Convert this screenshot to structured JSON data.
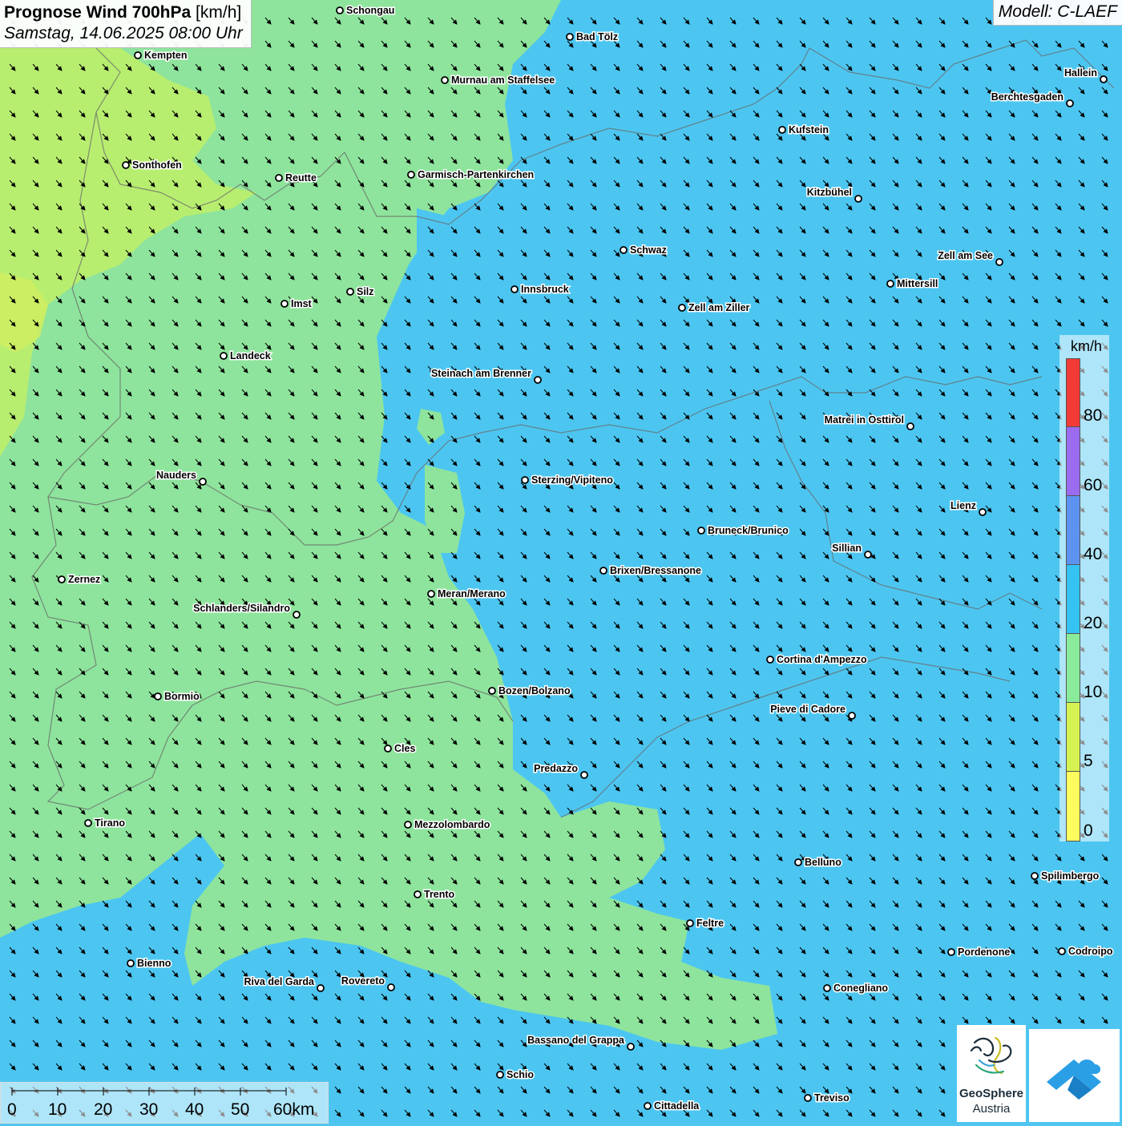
{
  "title": {
    "main": "Prognose Wind 700hPa",
    "unit": "[km/h]",
    "date": "Samstag, 14.06.2025 08:00 Uhr"
  },
  "model": "Modell: C-LAEF",
  "legend": {
    "unit": "km/h",
    "labels": [
      "80",
      "60",
      "40",
      "20",
      "10",
      "5",
      "0"
    ],
    "colors": [
      "#f23a36",
      "#9b6cf0",
      "#5c93f0",
      "#34c3f3",
      "#8aec9a",
      "#d5f253",
      "#fcfc5f"
    ]
  },
  "scale": {
    "labels": [
      "0",
      "10",
      "20",
      "30",
      "40",
      "50",
      "60km"
    ]
  },
  "logo": {
    "line1": "GeoSphere",
    "line2": "Austria"
  },
  "icons": [
    "city-marker-icon",
    "wind-arrow-icon",
    "geosphere-logo-icon",
    "app-logo-icon"
  ],
  "cities": [
    "Schongau",
    "Bad Tölz",
    "Kempten",
    "Murnau am Staffelsee",
    "Hallein",
    "Berchtesgaden",
    "Kufstein",
    "Sonthofen",
    "Reutte",
    "Garmisch-Partenkirchen",
    "Kitzbühel",
    "Schwaz",
    "Zell am See",
    "Mittersill",
    "Innsbruck",
    "Silz",
    "Imst",
    "Zell am Ziller",
    "Landeck",
    "Steinach am Brenner",
    "Matrei in Osttirol",
    "Nauders",
    "Sterzing/Vipiteno",
    "Lienz",
    "Bruneck/Brunico",
    "Sillian",
    "Brixen/Bressanone",
    "Zernez",
    "Meran/Merano",
    "Schlanders/Silandro",
    "Cortina d'Ampezzo",
    "Bozen/Bolzano",
    "Bormio",
    "Pieve di Cadore",
    "Cles",
    "Predazzo",
    "Tirano",
    "Mezzolombardo",
    "Belluno",
    "Spilimbergo",
    "Trento",
    "Feltre",
    "Bienno",
    "Pordenone",
    "Codroipo",
    "Riva del Garda",
    "Rovereto",
    "Conegliano",
    "Bassano del Grappa",
    "Schio",
    "Treviso",
    "Cittadella"
  ]
}
